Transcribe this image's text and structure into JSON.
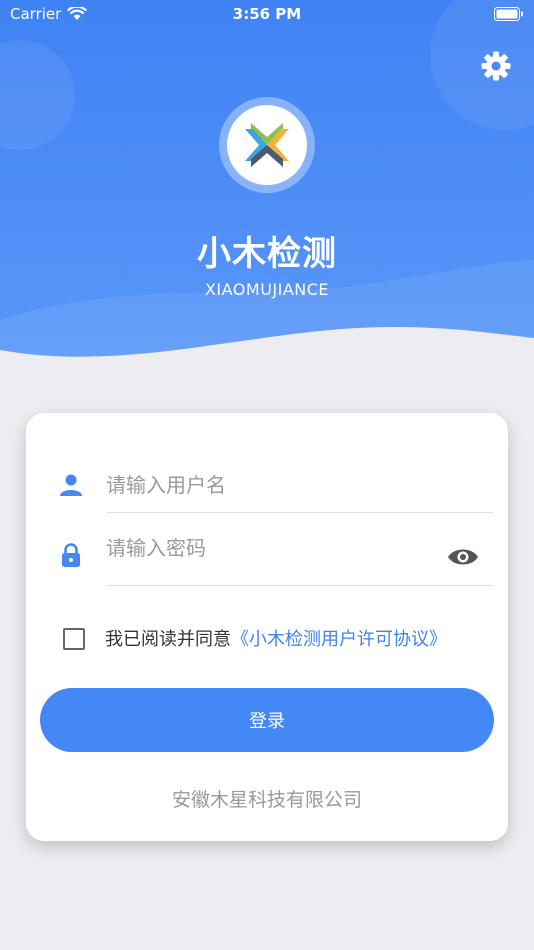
{
  "status_bar": {
    "carrier": "Carrier",
    "time": "3:56 PM"
  },
  "header": {
    "title": "小木检测",
    "subtitle": "XIAOMUJIANCE"
  },
  "login": {
    "username_placeholder": "请输入用户名",
    "password_placeholder": "请输入密码",
    "agreement_prefix": "我已阅读并同意",
    "agreement_link": "《小木检测用户许可协议》",
    "agreement_checked": false,
    "login_label": "登录",
    "company": "安徽木星科技有限公司"
  },
  "icons": {
    "settings": "gear-icon",
    "username": "user-icon",
    "password": "lock-icon",
    "toggle_password": "eye-icon",
    "wifi": "wifi-icon",
    "battery": "battery-icon"
  },
  "colors": {
    "primary": "#4488f6",
    "header_top": "#3f82f4",
    "background": "#ececf1",
    "link": "#3f82f4",
    "logo_green": "#8cc152",
    "logo_orange": "#f0b33c",
    "logo_blue": "#3da5d9",
    "logo_slate": "#4a5a70"
  }
}
